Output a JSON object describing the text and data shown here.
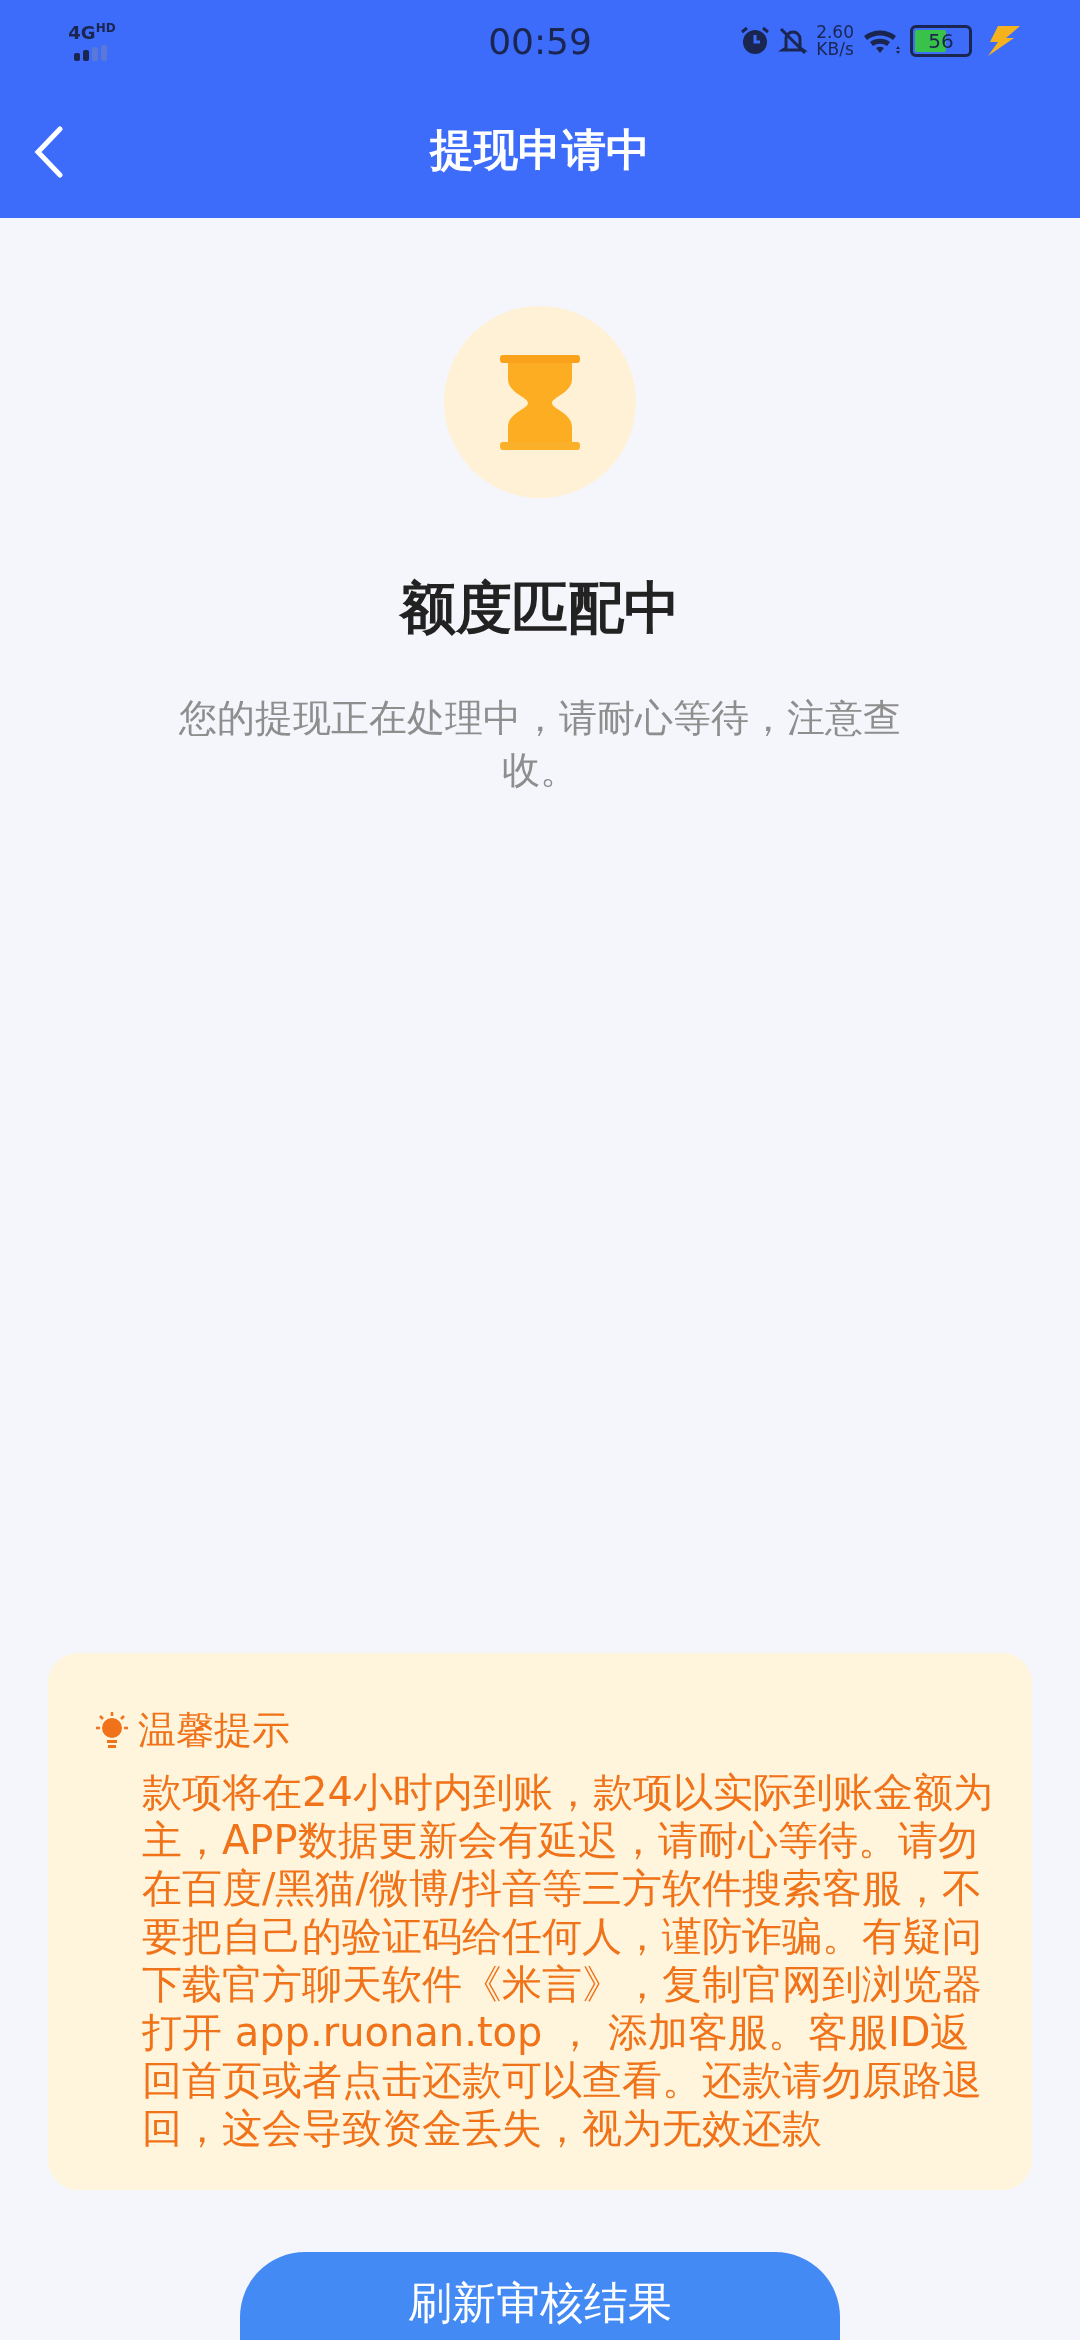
{
  "status_bar": {
    "network": "4G",
    "network_badge": "HD",
    "time": "00:59",
    "speed_value": "2.60",
    "speed_unit": "KB/s",
    "battery": "56"
  },
  "header": {
    "title": "提现申请中"
  },
  "status": {
    "title": "额度匹配中",
    "message": "您的提现正在处理中，请耐心等待，注意查收。"
  },
  "tips": {
    "title": "温馨提示",
    "body": "款项将在24小时内到账，款项以实际到账金额为主，APP数据更新会有延迟，请耐心等待。请勿在百度/黑猫/微博/抖音等三方软件搜索客服，不要把自己的验证码给任何人，谨防诈骗。有疑问下载官方聊天软件《米言》，复制官网到浏览器打开 app.ruonan.top ， 添加客服。客服ID返回首页或者点击还款可以查看。还款请勿原路退回，这会导致资金丢失，视为无效还款"
  },
  "button": {
    "label": "刷新审核结果"
  }
}
